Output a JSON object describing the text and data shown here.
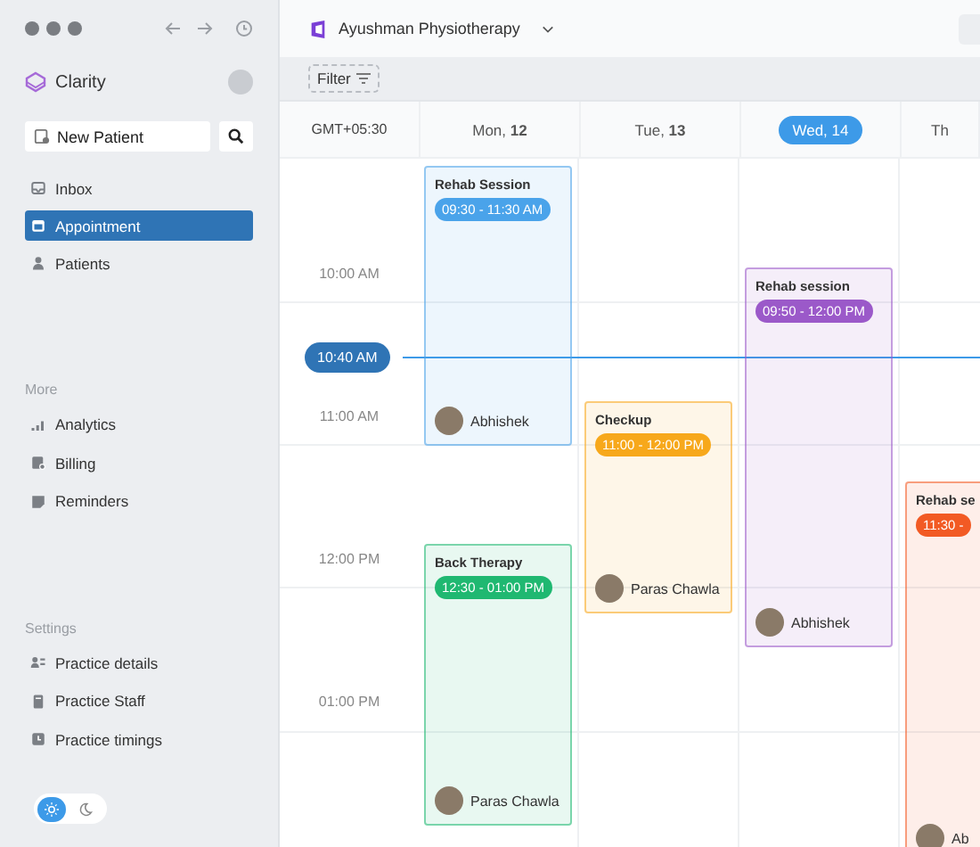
{
  "sidebar": {
    "brand": "Clarity",
    "new_patient_button": "New Patient",
    "nav": [
      {
        "label": "Inbox",
        "selected": false
      },
      {
        "label": "Appointment",
        "selected": true
      },
      {
        "label": "Patients",
        "selected": false
      }
    ],
    "sections": [
      {
        "heading": "More",
        "items": [
          "Analytics",
          "Billing",
          "Reminders"
        ]
      },
      {
        "heading": "Settings",
        "items": [
          "Practice details",
          "Practice Staff",
          "Practice timings"
        ]
      }
    ],
    "theme_toggle": [
      {
        "kind": "light",
        "selected": true
      },
      {
        "kind": "dark",
        "selected": false
      }
    ]
  },
  "header": {
    "practice": "Ayushman Physiotherapy",
    "filter_button": "Filter"
  },
  "calendar": {
    "timezone": "GMT+05:30",
    "time_labels": [
      "10:00 AM",
      "11:00 AM",
      "12:00 PM",
      "01:00 PM"
    ],
    "now_label": "10:40 AM",
    "days": [
      {
        "label": "Mon, **12**",
        "selected": false,
        "events": [
          {
            "title": "Rehab Session",
            "time": "09:30 - 11:30 AM",
            "person": "Abhishek",
            "color": "#4aa3ea"
          },
          {
            "title": "Back Therapy",
            "time": "12:30 - 01:00 PM",
            "person": "Paras Chawla",
            "color": "#1fb871"
          }
        ]
      },
      {
        "label": "Tue, **13**",
        "selected": false,
        "events": [
          {
            "title": "Checkup",
            "time": "11:00 - 12:00 PM",
            "person": "Paras Chawla",
            "color": "#f7a81b"
          }
        ]
      },
      {
        "label": "Wed, 14",
        "selected": true,
        "events": [
          {
            "title": "Rehab session",
            "time": "09:50 - 12:00 PM",
            "person": "Abhishek",
            "color": "#9b59c9"
          }
        ]
      },
      {
        "label": "Th",
        "selected": false,
        "events": [
          {
            "title": "Rehab se",
            "time": "11:30 -",
            "person": "Ab",
            "color": "#f25a24"
          }
        ]
      }
    ]
  }
}
